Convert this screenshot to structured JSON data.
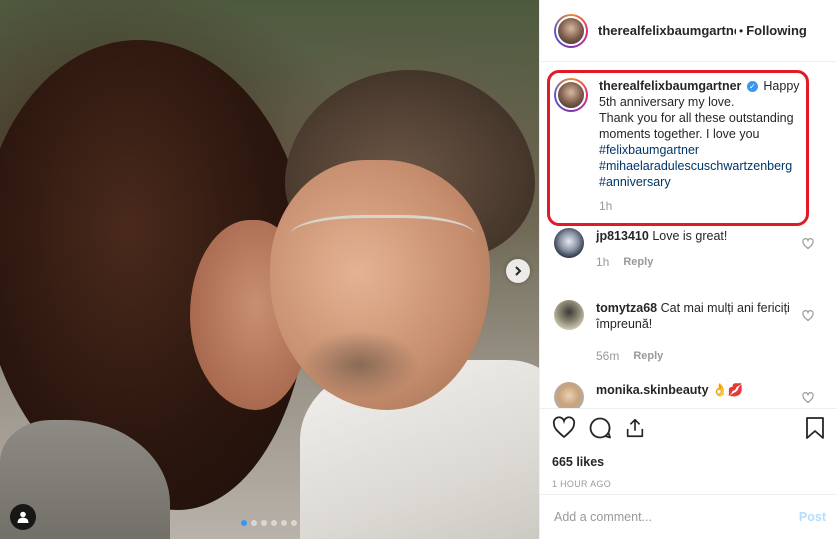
{
  "post": {
    "username": "therealfelixbaumgartner",
    "separator": "•",
    "follow_status": "Following"
  },
  "caption": {
    "username": "therealfelixbaumgartner",
    "verified_glyph": "✓",
    "line1": "Happy 5th anniversary my love.",
    "line2": "Thank you for all these outstanding moments together. I love you",
    "hashtags": [
      "#felixbaumgartner",
      "#mihaelaradulescuschwartzenberg",
      "#anniversary"
    ],
    "time": "1h"
  },
  "comments": [
    {
      "username": "jp813410",
      "text": "Love is great!",
      "time": "1h",
      "reply": "Reply"
    },
    {
      "username": "tomytza68",
      "text": "Cat mai mulți ani fericiți împreună!",
      "time": "56m",
      "reply": "Reply"
    },
    {
      "username": "monika.skinbeauty",
      "text": "👌💋"
    }
  ],
  "stats": {
    "likes": "665 likes",
    "posted": "1 HOUR AGO"
  },
  "compose": {
    "placeholder": "Add a comment...",
    "post_label": "Post"
  },
  "carousel": {
    "slide_count": 6,
    "active_index": 0
  },
  "colors": {
    "accent_blue": "#3897f0",
    "hashtag": "#003569",
    "highlight_red": "#e11a26",
    "muted": "#999999",
    "post_disabled": "#b2dffc"
  },
  "icons": [
    "next-arrow-icon",
    "user-tag-icon",
    "heart-icon",
    "comment-icon",
    "share-icon",
    "bookmark-icon",
    "verified-icon"
  ]
}
